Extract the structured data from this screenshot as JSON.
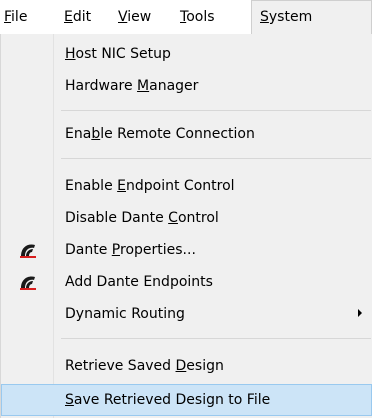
{
  "menubar": {
    "items": [
      {
        "pre": "",
        "key": "F",
        "post": "ile"
      },
      {
        "pre": "",
        "key": "E",
        "post": "dit"
      },
      {
        "pre": "",
        "key": "V",
        "post": "iew"
      },
      {
        "pre": "",
        "key": "T",
        "post": "ools"
      },
      {
        "pre": "",
        "key": "S",
        "post": "ystem"
      }
    ],
    "active_index": 4
  },
  "system_menu": {
    "items": [
      {
        "pre": "",
        "key": "H",
        "post": "ost NIC Setup"
      },
      {
        "pre": "Hardware ",
        "key": "M",
        "post": "anager"
      },
      {
        "pre": "Ena",
        "key": "b",
        "post": "le Remote Connection"
      },
      {
        "pre": "Enable ",
        "key": "E",
        "post": "ndpoint Control"
      },
      {
        "pre": "Disable Dante ",
        "key": "C",
        "post": "ontrol"
      },
      {
        "pre": "Dante ",
        "key": "P",
        "post": "roperties...",
        "icon": "dante-logo-icon"
      },
      {
        "pre": "Add Dante Endpoints",
        "key": "",
        "post": "",
        "icon": "dante-logo-icon"
      },
      {
        "pre": "Dynamic Routing",
        "key": "",
        "post": "",
        "submenu": true
      },
      {
        "pre": "Retrieve Saved ",
        "key": "D",
        "post": "esign"
      },
      {
        "pre": "",
        "key": "S",
        "post": "ave Retrieved Design to File",
        "highlighted": true
      }
    ]
  },
  "colors": {
    "menu_background": "#f0f0f0",
    "highlight_fill": "#cce4f7",
    "highlight_border": "#99c9ef",
    "icon_red": "#d81e1e"
  }
}
